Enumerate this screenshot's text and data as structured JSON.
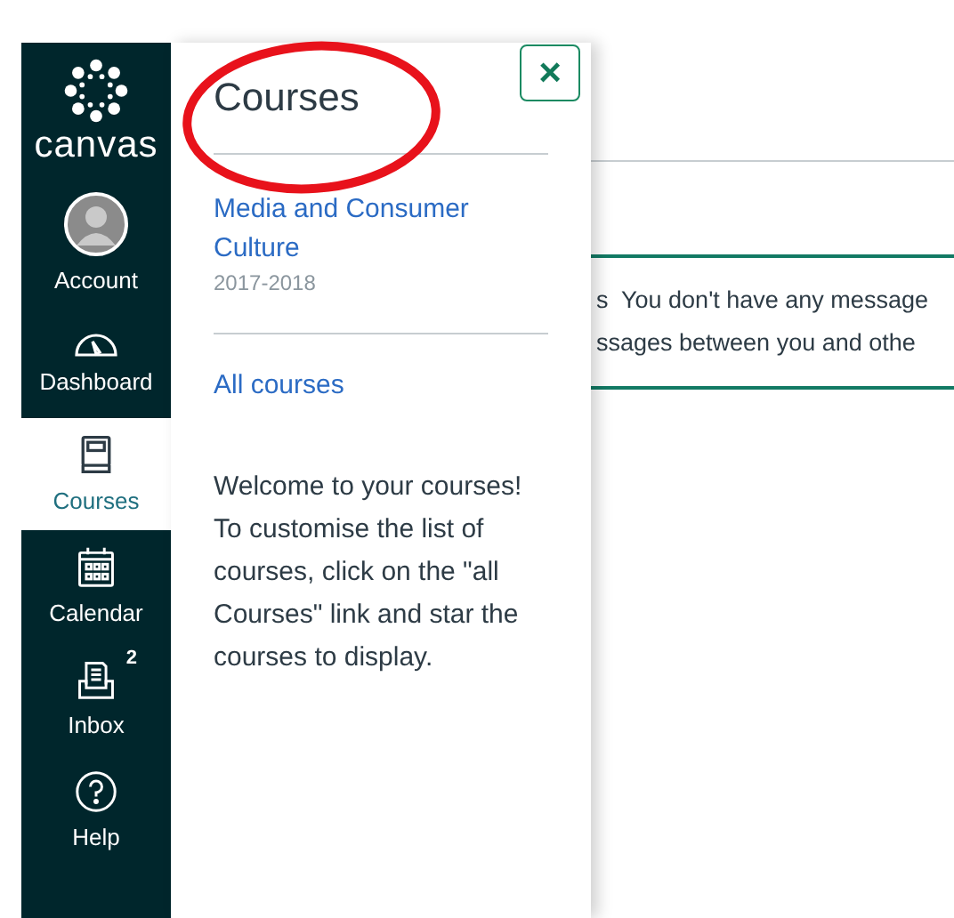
{
  "app_logo": {
    "text": "canvas"
  },
  "global_nav": [
    {
      "label": "Account",
      "kind": "avatar",
      "selected": false
    },
    {
      "label": "Dashboard",
      "kind": "dashboard",
      "selected": false
    },
    {
      "label": "Courses",
      "kind": "book",
      "selected": true
    },
    {
      "label": "Calendar",
      "kind": "calendar",
      "selected": false
    },
    {
      "label": "Inbox",
      "kind": "inbox",
      "selected": false,
      "badge": "2"
    },
    {
      "label": "Help",
      "kind": "help",
      "selected": false
    }
  ],
  "tray": {
    "title": "Courses",
    "close_label": "×",
    "courses": [
      {
        "name": "Media and Consumer Culture",
        "term": "2017-2018"
      }
    ],
    "all_courses_link": "All courses",
    "message": "Welcome to your courses! To customise the list of courses, click on the \"all Courses\" link and star the courses to display."
  },
  "content": {
    "notice_lines": [
      "s  You don't have any message",
      "ssages between you and othe"
    ]
  },
  "annotation": {
    "kind": "ellipse"
  }
}
